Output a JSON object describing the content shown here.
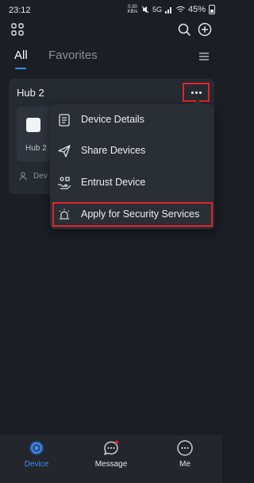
{
  "status_bar": {
    "time": "23:12",
    "speed": "0.30 KB/s",
    "network_label": "5G",
    "battery": "45%"
  },
  "topbar": {
    "grid_icon": "grid-icon",
    "search_icon": "search-icon",
    "add_icon": "plus-circle-icon"
  },
  "tabs": [
    {
      "label": "All",
      "active": true
    },
    {
      "label": "Favorites",
      "active": false
    }
  ],
  "hub": {
    "title": "Hub 2",
    "device_name": "Hub 2",
    "share_text": "Dev"
  },
  "dropdown": {
    "items": [
      {
        "label": "Device Details",
        "icon": "document-icon"
      },
      {
        "label": "Share Devices",
        "icon": "send-icon"
      },
      {
        "label": "Entrust Device",
        "icon": "hand-icon"
      },
      {
        "label": "Apply for Security Services",
        "icon": "alarm-icon"
      }
    ]
  },
  "bottom_nav": [
    {
      "label": "Device",
      "icon": "device-icon",
      "active": true
    },
    {
      "label": "Message",
      "icon": "message-icon",
      "active": false
    },
    {
      "label": "Me",
      "icon": "me-icon",
      "active": false
    }
  ],
  "colors": {
    "accent": "#3d8cff",
    "highlight": "#e0242a",
    "background": "#1b1e24"
  }
}
